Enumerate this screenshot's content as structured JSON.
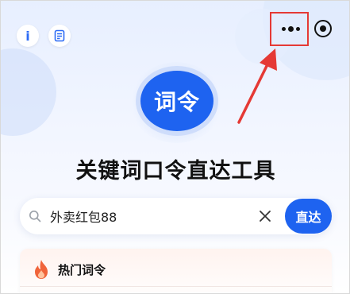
{
  "header": {
    "info_icon_glyph": "i",
    "more_icon": "more-dots-icon",
    "target_icon": "target-icon",
    "highlight_color": "#e53935"
  },
  "logo": {
    "text": "词令",
    "color": "#1e63f0"
  },
  "title": "关键词口令直达工具",
  "search": {
    "value": "外卖红包88",
    "go_label": "直达"
  },
  "hot": {
    "title": "热门词令"
  },
  "colors": {
    "accent": "#1e63f0",
    "flame": "#f0643a"
  }
}
